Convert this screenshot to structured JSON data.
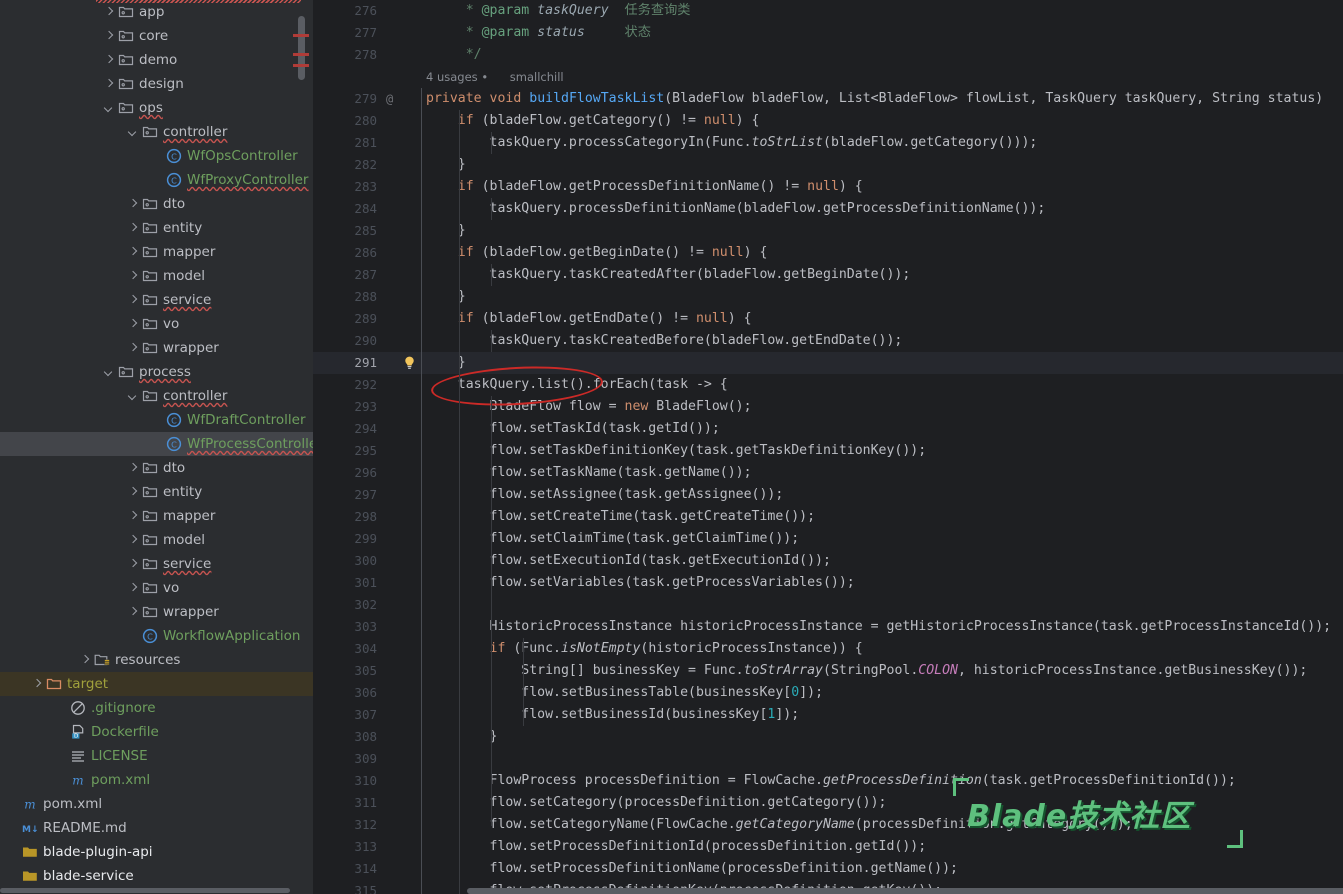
{
  "app": {
    "kind": "ide-code-editor",
    "theme_bg": "#1e1f22",
    "panel_bg": "#2b2d30",
    "selection_bg": "#43454a",
    "accent_error": "#c75450",
    "annotation_color": "#cc2a27"
  },
  "tree": {
    "name": "project-tree",
    "items": [
      {
        "label": "app",
        "indent": 4,
        "twist": "closed",
        "icon": "package-folder-icon",
        "style": "dim",
        "wavy": false
      },
      {
        "label": "core",
        "indent": 4,
        "twist": "closed",
        "icon": "package-folder-icon",
        "style": "dim",
        "wavy": false
      },
      {
        "label": "demo",
        "indent": 4,
        "twist": "closed",
        "icon": "package-folder-icon",
        "style": "dim",
        "wavy": false
      },
      {
        "label": "design",
        "indent": 4,
        "twist": "closed",
        "icon": "package-folder-icon",
        "style": "dim",
        "wavy": false
      },
      {
        "label": "ops",
        "indent": 4,
        "twist": "open",
        "icon": "package-folder-icon",
        "style": "dim",
        "wavy": true
      },
      {
        "label": "controller",
        "indent": 5,
        "twist": "open",
        "icon": "package-folder-icon",
        "style": "dim",
        "wavy": true
      },
      {
        "label": "WfOpsController",
        "indent": 6,
        "twist": "none",
        "icon": "java-class-icon",
        "style": "green",
        "wavy": false
      },
      {
        "label": "WfProxyController",
        "indent": 6,
        "twist": "none",
        "icon": "java-class-icon",
        "style": "green",
        "wavy": true
      },
      {
        "label": "dto",
        "indent": 5,
        "twist": "closed",
        "icon": "package-folder-icon",
        "style": "dim",
        "wavy": false
      },
      {
        "label": "entity",
        "indent": 5,
        "twist": "closed",
        "icon": "package-folder-icon",
        "style": "dim",
        "wavy": false
      },
      {
        "label": "mapper",
        "indent": 5,
        "twist": "closed",
        "icon": "package-folder-icon",
        "style": "dim",
        "wavy": false
      },
      {
        "label": "model",
        "indent": 5,
        "twist": "closed",
        "icon": "package-folder-icon",
        "style": "dim",
        "wavy": false
      },
      {
        "label": "service",
        "indent": 5,
        "twist": "closed",
        "icon": "package-folder-icon",
        "style": "dim",
        "wavy": true
      },
      {
        "label": "vo",
        "indent": 5,
        "twist": "closed",
        "icon": "package-folder-icon",
        "style": "dim",
        "wavy": false
      },
      {
        "label": "wrapper",
        "indent": 5,
        "twist": "closed",
        "icon": "package-folder-icon",
        "style": "dim",
        "wavy": false
      },
      {
        "label": "process",
        "indent": 4,
        "twist": "open",
        "icon": "package-folder-icon",
        "style": "dim",
        "wavy": true
      },
      {
        "label": "controller",
        "indent": 5,
        "twist": "open",
        "icon": "package-folder-icon",
        "style": "dim",
        "wavy": true
      },
      {
        "label": "WfDraftController",
        "indent": 6,
        "twist": "none",
        "icon": "java-class-icon",
        "style": "green",
        "wavy": false
      },
      {
        "label": "WfProcessController",
        "indent": 6,
        "twist": "none",
        "icon": "java-class-icon",
        "style": "green",
        "wavy": true,
        "selected": true
      },
      {
        "label": "dto",
        "indent": 5,
        "twist": "closed",
        "icon": "package-folder-icon",
        "style": "dim",
        "wavy": false
      },
      {
        "label": "entity",
        "indent": 5,
        "twist": "closed",
        "icon": "package-folder-icon",
        "style": "dim",
        "wavy": false
      },
      {
        "label": "mapper",
        "indent": 5,
        "twist": "closed",
        "icon": "package-folder-icon",
        "style": "dim",
        "wavy": false
      },
      {
        "label": "model",
        "indent": 5,
        "twist": "closed",
        "icon": "package-folder-icon",
        "style": "dim",
        "wavy": false
      },
      {
        "label": "service",
        "indent": 5,
        "twist": "closed",
        "icon": "package-folder-icon",
        "style": "dim",
        "wavy": true
      },
      {
        "label": "vo",
        "indent": 5,
        "twist": "closed",
        "icon": "package-folder-icon",
        "style": "dim",
        "wavy": false
      },
      {
        "label": "wrapper",
        "indent": 5,
        "twist": "closed",
        "icon": "package-folder-icon",
        "style": "dim",
        "wavy": false
      },
      {
        "label": "WorkflowApplication",
        "indent": 5,
        "twist": "none",
        "icon": "java-class-icon",
        "style": "green",
        "wavy": false
      },
      {
        "label": "resources",
        "indent": 3,
        "twist": "closed",
        "icon": "resources-folder-icon",
        "style": "dim",
        "wavy": false
      },
      {
        "label": "target",
        "indent": 1,
        "twist": "closed",
        "icon": "excluded-folder-icon",
        "style": "olive",
        "wavy": false,
        "highlight": true
      },
      {
        "label": ".gitignore",
        "indent": 2,
        "twist": "none",
        "icon": "gitignore-icon",
        "style": "green",
        "wavy": false
      },
      {
        "label": "Dockerfile",
        "indent": 2,
        "twist": "none",
        "icon": "docker-icon",
        "style": "green",
        "wavy": false
      },
      {
        "label": "LICENSE",
        "indent": 2,
        "twist": "none",
        "icon": "text-file-icon",
        "style": "green",
        "wavy": false
      },
      {
        "label": "pom.xml",
        "indent": 2,
        "twist": "none",
        "icon": "maven-icon",
        "style": "green",
        "wavy": false
      },
      {
        "label": "pom.xml",
        "indent": 0,
        "twist": "none",
        "icon": "maven-icon",
        "style": "dim",
        "wavy": false
      },
      {
        "label": "README.md",
        "indent": 0,
        "twist": "none",
        "icon": "markdown-icon",
        "style": "dim",
        "wavy": false
      },
      {
        "label": "blade-plugin-api",
        "indent": -1,
        "twist": "none",
        "icon": "module-icon",
        "style": "white",
        "wavy": false
      },
      {
        "label": "blade-service",
        "indent": -1,
        "twist": "none",
        "icon": "module-icon",
        "style": "white",
        "wavy": false
      }
    ]
  },
  "editor": {
    "name": "code-editor",
    "language": "java",
    "current_line": 291,
    "inlay": {
      "usages": "4 usages",
      "author": "smallchill"
    },
    "annotation": {
      "shape": "red-ellipse",
      "encircles": "taskQuery.list()"
    },
    "watermark": {
      "text": "Blade技术社区",
      "color": "#5ec07e"
    },
    "lines": [
      {
        "n": 276,
        "html": "<span class=\"doc\">     * </span><span class=\"tag\">@param</span><span class=\"doc\"> </span><span class=\"pv\">taskQuery</span><span class=\"doc\">  任务查询类</span>"
      },
      {
        "n": 277,
        "html": "<span class=\"doc\">     * </span><span class=\"tag\">@param</span><span class=\"doc\"> </span><span class=\"pv\">status</span><span class=\"doc\">     状态</span>"
      },
      {
        "n": 278,
        "html": "<span class=\"doc\">     */</span>"
      },
      {
        "n": 279,
        "at": true,
        "html": "<span class=\"k\">private</span> <span class=\"k\">void</span> <span class=\"m\">buildFlowTaskList</span>(BladeFlow bladeFlow, List&lt;BladeFlow&gt; flowList, TaskQuery taskQuery, String status)"
      },
      {
        "n": 280,
        "html": "    <span class=\"k\">if</span> (bladeFlow.getCategory() != <span class=\"k\">null</span>) {"
      },
      {
        "n": 281,
        "html": "        taskQuery.processCategoryIn(Func.<span class=\"it\">toStrList</span>(bladeFlow.getCategory()));"
      },
      {
        "n": 282,
        "html": "    }"
      },
      {
        "n": 283,
        "html": "    <span class=\"k\">if</span> (bladeFlow.getProcessDefinitionName() != <span class=\"k\">null</span>) {"
      },
      {
        "n": 284,
        "html": "        taskQuery.processDefinitionName(bladeFlow.getProcessDefinitionName());"
      },
      {
        "n": 285,
        "html": "    }"
      },
      {
        "n": 286,
        "html": "    <span class=\"k\">if</span> (bladeFlow.getBeginDate() != <span class=\"k\">null</span>) {"
      },
      {
        "n": 287,
        "html": "        taskQuery.taskCreatedAfter(bladeFlow.getBeginDate());"
      },
      {
        "n": 288,
        "html": "    }"
      },
      {
        "n": 289,
        "html": "    <span class=\"k\">if</span> (bladeFlow.getEndDate() != <span class=\"k\">null</span>) {"
      },
      {
        "n": 290,
        "html": "        taskQuery.taskCreatedBefore(bladeFlow.getEndDate());"
      },
      {
        "n": 291,
        "cur": true,
        "bulb": true,
        "html": "    }"
      },
      {
        "n": 292,
        "html": "    taskQuery.list().forEach(task -&gt; {"
      },
      {
        "n": 293,
        "html": "        BladeFlow flow = <span class=\"k\">new</span> BladeFlow();"
      },
      {
        "n": 294,
        "html": "        flow.setTaskId(task.getId());"
      },
      {
        "n": 295,
        "html": "        flow.setTaskDefinitionKey(task.getTaskDefinitionKey());"
      },
      {
        "n": 296,
        "html": "        flow.setTaskName(task.getName());"
      },
      {
        "n": 297,
        "html": "        flow.setAssignee(task.getAssignee());"
      },
      {
        "n": 298,
        "html": "        flow.setCreateTime(task.getCreateTime());"
      },
      {
        "n": 299,
        "html": "        flow.setClaimTime(task.getClaimTime());"
      },
      {
        "n": 300,
        "html": "        flow.setExecutionId(task.getExecutionId());"
      },
      {
        "n": 301,
        "html": "        flow.setVariables(task.getProcessVariables());"
      },
      {
        "n": 302,
        "html": ""
      },
      {
        "n": 303,
        "html": "        HistoricProcessInstance historicProcessInstance = getHistoricProcessInstance(task.getProcessInstanceId());"
      },
      {
        "n": 304,
        "html": "        <span class=\"k\">if</span> (Func.<span class=\"it\">isNotEmpty</span>(historicProcessInstance)) {"
      },
      {
        "n": 305,
        "html": "            String[] businessKey = Func.<span class=\"it\">toStrArray</span>(StringPool.<span class=\"cst\">COLON</span>, historicProcessInstance.getBusinessKey());"
      },
      {
        "n": 306,
        "html": "            flow.setBusinessTable(businessKey[<span class=\"num\">0</span>]);"
      },
      {
        "n": 307,
        "html": "            flow.setBusinessId(businessKey[<span class=\"num\">1</span>]);"
      },
      {
        "n": 308,
        "html": "        }"
      },
      {
        "n": 309,
        "html": ""
      },
      {
        "n": 310,
        "html": "        FlowProcess processDefinition = FlowCache.<span class=\"it\">getProcessDefinition</span>(task.getProcessDefinitionId());"
      },
      {
        "n": 311,
        "html": "        flow.setCategory(processDefinition.getCategory());"
      },
      {
        "n": 312,
        "html": "        flow.setCategoryName(FlowCache.<span class=\"it\">getCategoryName</span>(processDefinition.getCategory()));"
      },
      {
        "n": 313,
        "html": "        flow.setProcessDefinitionId(processDefinition.getId());"
      },
      {
        "n": 314,
        "html": "        flow.setProcessDefinitionName(processDefinition.getName());"
      },
      {
        "n": 315,
        "html": "        flow.setProcessDefinitionKey(processDefinition.getKey());"
      }
    ]
  }
}
